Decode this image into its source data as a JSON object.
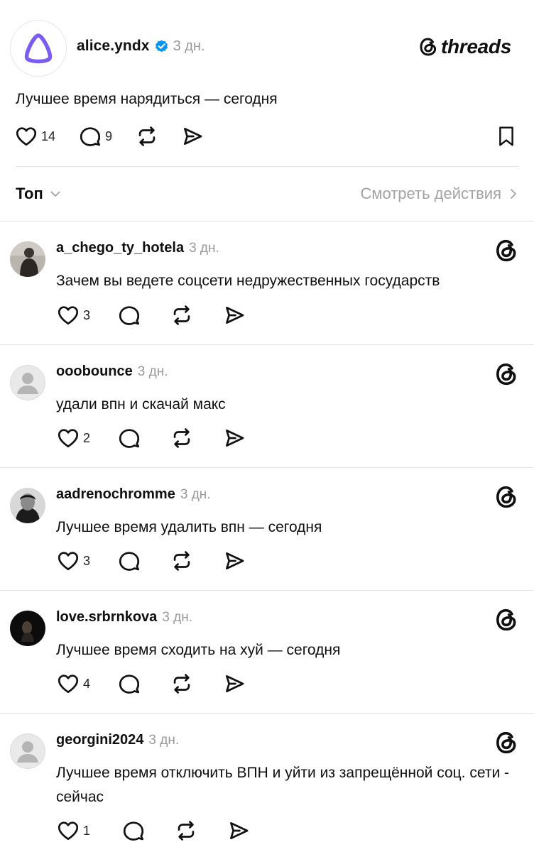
{
  "brand": {
    "logo_text": "threads",
    "accent": "#0095f6",
    "alice_color": "#7b5cf0"
  },
  "post": {
    "username": "alice.yndx",
    "time": "3 дн.",
    "text": "Лучшее время нарядиться — сегодня",
    "likes": "14",
    "replies": "9"
  },
  "sort": {
    "label": "Топ",
    "activity_link": "Смотреть действия"
  },
  "replies": [
    {
      "username": "a_chego_ty_hotela",
      "time": "3 дн.",
      "text": "Зачем вы ведете соцсети недружественных государств",
      "likes": "3"
    },
    {
      "username": "ooobounce",
      "time": "3 дн.",
      "text": "удали впн и скачай макс",
      "likes": "2"
    },
    {
      "username": "aadrenochromme",
      "time": "3 дн.",
      "text": "Лучшее время удалить впн — сегодня",
      "likes": "3"
    },
    {
      "username": "love.srbrnkova",
      "time": "3 дн.",
      "text": "Лучшее время сходить на хуй — сегодня",
      "likes": "4"
    },
    {
      "username": "georgini2024",
      "time": "3 дн.",
      "text": "Лучшее время отключить ВПН и уйти из запрещённой соц. сети - сейчас",
      "likes": "1"
    }
  ]
}
